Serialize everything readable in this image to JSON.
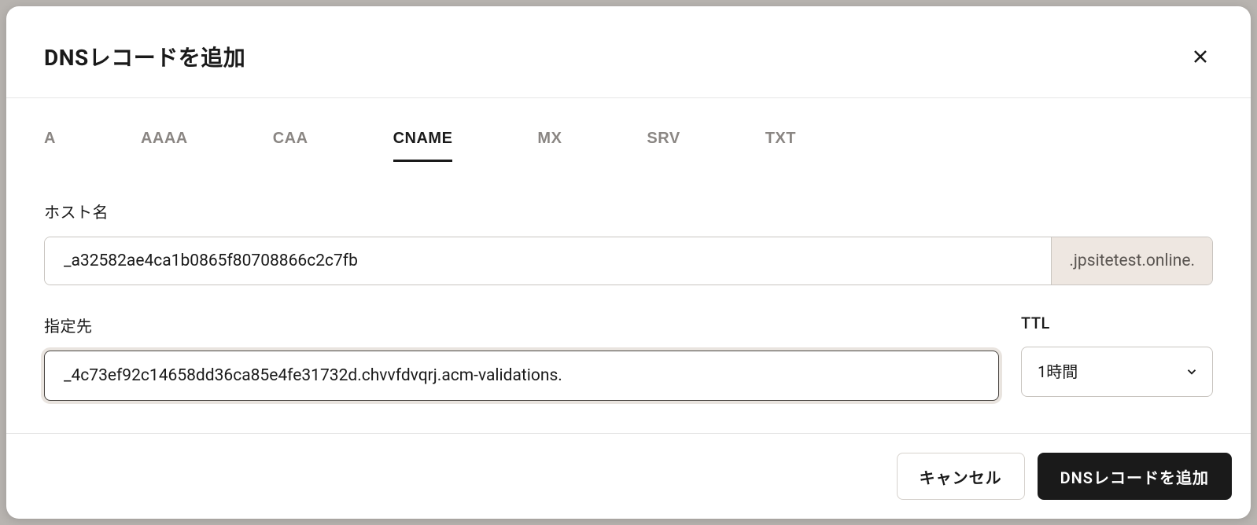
{
  "modal": {
    "title": "DNSレコードを追加"
  },
  "tabs": {
    "a": "A",
    "aaaa": "AAAA",
    "caa": "CAA",
    "cname": "CNAME",
    "mx": "MX",
    "srv": "SRV",
    "txt": "TXT",
    "active": "cname"
  },
  "form": {
    "hostname": {
      "label": "ホスト名",
      "value": "_a32582ae4ca1b0865f80708866c2c7fb",
      "suffix": ".jpsitetest.online."
    },
    "target": {
      "label": "指定先",
      "value": "_4c73ef92c14658dd36ca85e4fe31732d.chvvfdvqrj.acm-validations."
    },
    "ttl": {
      "label": "TTL",
      "value": "1時間"
    }
  },
  "footer": {
    "cancel": "キャンセル",
    "submit": "DNSレコードを追加"
  }
}
